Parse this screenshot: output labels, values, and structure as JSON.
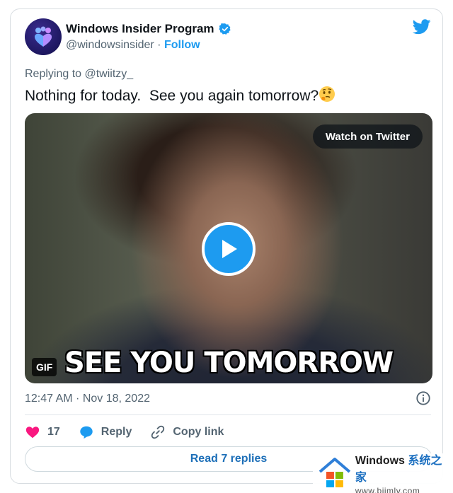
{
  "tweet": {
    "author_name": "Windows Insider Program",
    "handle": "@windowsinsider",
    "separator": " · ",
    "follow_label": "Follow",
    "replying_to": "Replying to @twiitzy_",
    "text": "Nothing for today.  See you again tomorrow?",
    "emoji": "thinking-face",
    "media": {
      "watch_label": "Watch on Twitter",
      "gif_badge": "GIF",
      "caption": "SEE YOU TOMORROW"
    },
    "timestamp": "12:47 AM · Nov 18, 2022",
    "likes_count": "17",
    "reply_label": "Reply",
    "copy_link_label": "Copy link",
    "read_replies_label": "Read 7 replies"
  },
  "watermark": {
    "title": "Windows",
    "title_cn": "系统之家",
    "url": "www.bjjmlv.com"
  },
  "colors": {
    "twitter_blue": "#1d9bf0",
    "like_pink": "#f91880",
    "text_primary": "#0f1419",
    "text_secondary": "#536471"
  }
}
